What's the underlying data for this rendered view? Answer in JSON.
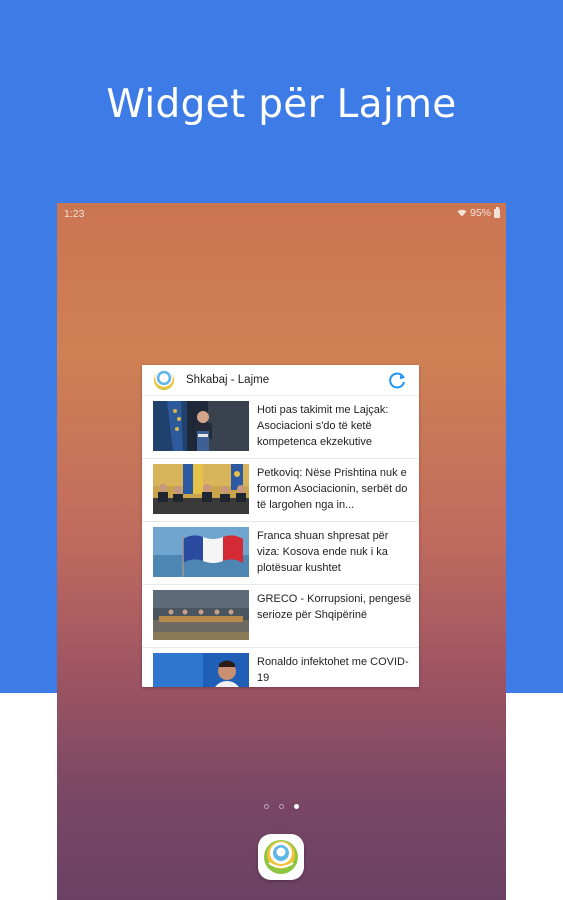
{
  "promo": {
    "title": "Widget për Lajme"
  },
  "status_bar": {
    "time": "1:23",
    "battery": "95%"
  },
  "widget": {
    "title": "Shkabaj - Lajme",
    "news": [
      {
        "title": "Hoti pas takimit me Lajçak: Asociacioni s'do të ketë kompetenca ekzekutive",
        "thumb": "meeting-podium"
      },
      {
        "title": "Petkoviq: Nëse Prishtina nuk e formon Asociacionin, serbët do të largohen nga in...",
        "thumb": "press-conference-flags"
      },
      {
        "title": "Franca shuan shpresat për viza: Kosova ende nuk i ka plotësuar kushtet",
        "thumb": "france-flag"
      },
      {
        "title": "GRECO - Korrupsioni, pengesë serioze për Shqipërinë",
        "thumb": "council-hall"
      },
      {
        "title": "Ronaldo infektohet me COVID-19",
        "thumb": "ronaldo"
      }
    ]
  },
  "home": {
    "pages": 3,
    "active_page": 3
  },
  "colors": {
    "promo_blue": "#3d7be6",
    "accent": "#2196f3"
  }
}
